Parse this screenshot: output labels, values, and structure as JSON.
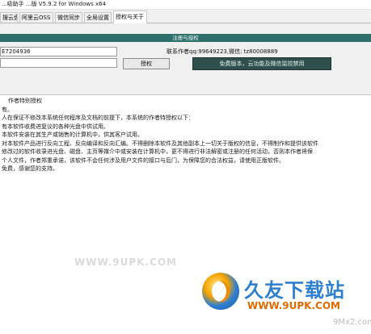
{
  "window": {
    "title": "...吸助手 ...版 V5.9.2 for Windows x64"
  },
  "tabs": [
    {
      "label": "搜云盘"
    },
    {
      "label": "阿里云OSS"
    },
    {
      "label": "微信同步"
    },
    {
      "label": "全局设置"
    },
    {
      "label": "授权与关于"
    }
  ],
  "license_panel": {
    "section_title": "注册与授权",
    "machine_code": "E7204936",
    "license_key": "",
    "author_info": "联系作者qq:99649223,微信: tz80008889",
    "authorize_label": "授权",
    "free_version_label": "免费版本，云功能及微信监控禁用"
  },
  "license_text": {
    "lines": [
      "",
      "作者特别授权",
      "有。",
      "人在保证不修改本系统任何程序及文档的前提下，本系统的作者特授权以下：",
      "有本软件收费进复议的各种光盘中供试用。",
      "本软件安装在其生产或销售的计算机中，供其客户试用。",
      "对本软件产品进行反向工程、反向编译和反向汇编。不得删除本软件及其他副本上一切关于版权的信息，不得制作和提供该软件",
      "修改过的软件收录进光盘、磁盘、主页等媒介中或安装在计算机中，更不得进行非法解密或注册的任何活动，否则本作者将保",
      "",
      "",
      "个人文件，作者郑重承诺，该软件不会任何涉及用户文件的接口与后门，为保障您的合法权益，请使用正版软件。",
      "免费，感谢您的支持。"
    ],
    "watermark": "WWW.9UPK.COM"
  },
  "brand": {
    "name": "久友下载站",
    "url": "WWW.9UPK.COM",
    "sub": "9Mx2.com"
  }
}
